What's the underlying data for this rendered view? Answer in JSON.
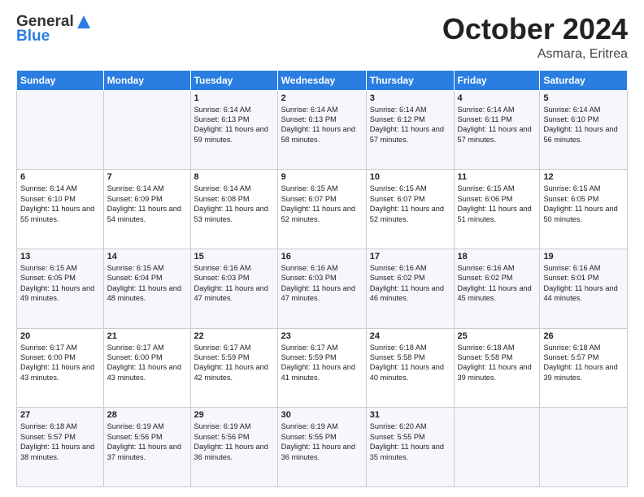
{
  "header": {
    "logo_general": "General",
    "logo_blue": "Blue",
    "month": "October 2024",
    "location": "Asmara, Eritrea"
  },
  "days_of_week": [
    "Sunday",
    "Monday",
    "Tuesday",
    "Wednesday",
    "Thursday",
    "Friday",
    "Saturday"
  ],
  "weeks": [
    [
      {
        "day": "",
        "content": ""
      },
      {
        "day": "",
        "content": ""
      },
      {
        "day": "1",
        "content": "Sunrise: 6:14 AM\nSunset: 6:13 PM\nDaylight: 11 hours and 59 minutes."
      },
      {
        "day": "2",
        "content": "Sunrise: 6:14 AM\nSunset: 6:13 PM\nDaylight: 11 hours and 58 minutes."
      },
      {
        "day": "3",
        "content": "Sunrise: 6:14 AM\nSunset: 6:12 PM\nDaylight: 11 hours and 57 minutes."
      },
      {
        "day": "4",
        "content": "Sunrise: 6:14 AM\nSunset: 6:11 PM\nDaylight: 11 hours and 57 minutes."
      },
      {
        "day": "5",
        "content": "Sunrise: 6:14 AM\nSunset: 6:10 PM\nDaylight: 11 hours and 56 minutes."
      }
    ],
    [
      {
        "day": "6",
        "content": "Sunrise: 6:14 AM\nSunset: 6:10 PM\nDaylight: 11 hours and 55 minutes."
      },
      {
        "day": "7",
        "content": "Sunrise: 6:14 AM\nSunset: 6:09 PM\nDaylight: 11 hours and 54 minutes."
      },
      {
        "day": "8",
        "content": "Sunrise: 6:14 AM\nSunset: 6:08 PM\nDaylight: 11 hours and 53 minutes."
      },
      {
        "day": "9",
        "content": "Sunrise: 6:15 AM\nSunset: 6:07 PM\nDaylight: 11 hours and 52 minutes."
      },
      {
        "day": "10",
        "content": "Sunrise: 6:15 AM\nSunset: 6:07 PM\nDaylight: 11 hours and 52 minutes."
      },
      {
        "day": "11",
        "content": "Sunrise: 6:15 AM\nSunset: 6:06 PM\nDaylight: 11 hours and 51 minutes."
      },
      {
        "day": "12",
        "content": "Sunrise: 6:15 AM\nSunset: 6:05 PM\nDaylight: 11 hours and 50 minutes."
      }
    ],
    [
      {
        "day": "13",
        "content": "Sunrise: 6:15 AM\nSunset: 6:05 PM\nDaylight: 11 hours and 49 minutes."
      },
      {
        "day": "14",
        "content": "Sunrise: 6:15 AM\nSunset: 6:04 PM\nDaylight: 11 hours and 48 minutes."
      },
      {
        "day": "15",
        "content": "Sunrise: 6:16 AM\nSunset: 6:03 PM\nDaylight: 11 hours and 47 minutes."
      },
      {
        "day": "16",
        "content": "Sunrise: 6:16 AM\nSunset: 6:03 PM\nDaylight: 11 hours and 47 minutes."
      },
      {
        "day": "17",
        "content": "Sunrise: 6:16 AM\nSunset: 6:02 PM\nDaylight: 11 hours and 46 minutes."
      },
      {
        "day": "18",
        "content": "Sunrise: 6:16 AM\nSunset: 6:02 PM\nDaylight: 11 hours and 45 minutes."
      },
      {
        "day": "19",
        "content": "Sunrise: 6:16 AM\nSunset: 6:01 PM\nDaylight: 11 hours and 44 minutes."
      }
    ],
    [
      {
        "day": "20",
        "content": "Sunrise: 6:17 AM\nSunset: 6:00 PM\nDaylight: 11 hours and 43 minutes."
      },
      {
        "day": "21",
        "content": "Sunrise: 6:17 AM\nSunset: 6:00 PM\nDaylight: 11 hours and 43 minutes."
      },
      {
        "day": "22",
        "content": "Sunrise: 6:17 AM\nSunset: 5:59 PM\nDaylight: 11 hours and 42 minutes."
      },
      {
        "day": "23",
        "content": "Sunrise: 6:17 AM\nSunset: 5:59 PM\nDaylight: 11 hours and 41 minutes."
      },
      {
        "day": "24",
        "content": "Sunrise: 6:18 AM\nSunset: 5:58 PM\nDaylight: 11 hours and 40 minutes."
      },
      {
        "day": "25",
        "content": "Sunrise: 6:18 AM\nSunset: 5:58 PM\nDaylight: 11 hours and 39 minutes."
      },
      {
        "day": "26",
        "content": "Sunrise: 6:18 AM\nSunset: 5:57 PM\nDaylight: 11 hours and 39 minutes."
      }
    ],
    [
      {
        "day": "27",
        "content": "Sunrise: 6:18 AM\nSunset: 5:57 PM\nDaylight: 11 hours and 38 minutes."
      },
      {
        "day": "28",
        "content": "Sunrise: 6:19 AM\nSunset: 5:56 PM\nDaylight: 11 hours and 37 minutes."
      },
      {
        "day": "29",
        "content": "Sunrise: 6:19 AM\nSunset: 5:56 PM\nDaylight: 11 hours and 36 minutes."
      },
      {
        "day": "30",
        "content": "Sunrise: 6:19 AM\nSunset: 5:55 PM\nDaylight: 11 hours and 36 minutes."
      },
      {
        "day": "31",
        "content": "Sunrise: 6:20 AM\nSunset: 5:55 PM\nDaylight: 11 hours and 35 minutes."
      },
      {
        "day": "",
        "content": ""
      },
      {
        "day": "",
        "content": ""
      }
    ]
  ]
}
